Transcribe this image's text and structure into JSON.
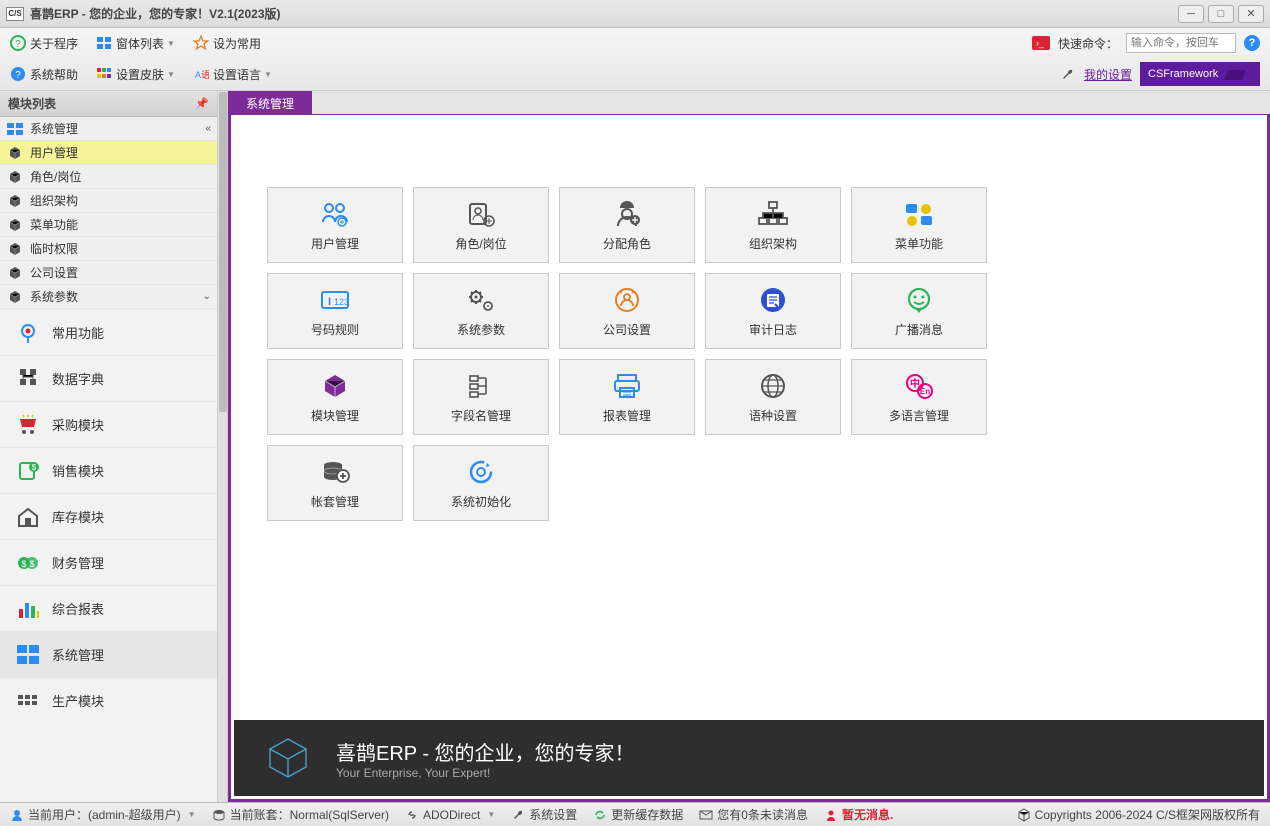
{
  "titlebar": {
    "logo": "C/S",
    "title": "喜鹊ERP - 您的企业，您的专家！V2.1(2023版)"
  },
  "toolbar": {
    "row1": {
      "about": "关于程序",
      "windows": "窗体列表",
      "set_common": "设为常用",
      "quick_cmd_label": "快速命令：",
      "quick_cmd_placeholder": "输入命令，按回车"
    },
    "row2": {
      "help": "系统帮助",
      "skin": "设置皮肤",
      "lang": "设置语言",
      "my_settings": "我的设置",
      "csframework": "CSFramework"
    }
  },
  "sidebar": {
    "title": "模块列表",
    "tree": [
      {
        "label": "系统管理",
        "top": true
      },
      {
        "label": "用户管理",
        "highlight": true
      },
      {
        "label": "角色/岗位"
      },
      {
        "label": "组织架构"
      },
      {
        "label": "菜单功能"
      },
      {
        "label": "临时权限"
      },
      {
        "label": "公司设置"
      },
      {
        "label": "系统参数",
        "expandable": true
      }
    ],
    "nav": [
      {
        "label": "常用功能",
        "icon": "pin"
      },
      {
        "label": "数据字典",
        "icon": "dict"
      },
      {
        "label": "采购模块",
        "icon": "cart"
      },
      {
        "label": "销售模块",
        "icon": "sales"
      },
      {
        "label": "库存模块",
        "icon": "warehouse"
      },
      {
        "label": "财务管理",
        "icon": "finance"
      },
      {
        "label": "综合报表",
        "icon": "report"
      },
      {
        "label": "系统管理",
        "icon": "system",
        "selected": true
      },
      {
        "label": "生产模块",
        "icon": "production"
      }
    ]
  },
  "content": {
    "tab": "系统管理",
    "tiles": [
      {
        "label": "用户管理",
        "color": "#2d8cf0",
        "icon": "users"
      },
      {
        "label": "角色/岗位",
        "color": "#555",
        "icon": "role"
      },
      {
        "label": "分配角色",
        "color": "#555",
        "icon": "assign"
      },
      {
        "label": "组织架构",
        "color": "#555",
        "icon": "org"
      },
      {
        "label": "菜单功能",
        "color": "#2d8cf0",
        "icon": "menu"
      },
      {
        "label": "号码规则",
        "color": "#2d8cf0",
        "icon": "number"
      },
      {
        "label": "系统参数",
        "color": "#555",
        "icon": "gears"
      },
      {
        "label": "公司设置",
        "color": "#e67e22",
        "icon": "company"
      },
      {
        "label": "审计日志",
        "color": "#2d4fd0",
        "icon": "audit"
      },
      {
        "label": "广播消息",
        "color": "#2bb559",
        "icon": "broadcast"
      },
      {
        "label": "模块管理",
        "color": "#7d2b99",
        "icon": "module"
      },
      {
        "label": "字段名管理",
        "color": "#555",
        "icon": "fields"
      },
      {
        "label": "报表管理",
        "color": "#2d8cf0",
        "icon": "printer"
      },
      {
        "label": "语种设置",
        "color": "#555",
        "icon": "globe"
      },
      {
        "label": "多语言管理",
        "color": "#e6007e",
        "icon": "lang"
      },
      {
        "label": "帐套管理",
        "color": "#555",
        "icon": "accounts"
      },
      {
        "label": "系统初始化",
        "color": "#2d8cf0",
        "icon": "init"
      }
    ],
    "banner": {
      "title": "喜鹊ERP - 您的企业，您的专家！",
      "sub": "Your Enterprise, Your Expert!"
    }
  },
  "statusbar": {
    "user": "当前用户：(admin-超级用户)",
    "account": "当前账套：Normal(SqlServer)",
    "ado": "ADODirect",
    "settings": "系统设置",
    "refresh": "更新缓存数据",
    "unread": "您有0条未读消息",
    "nomsg": "暂无消息.",
    "copyright": "Copyrights 2006-2024 C/S框架网版权所有"
  }
}
